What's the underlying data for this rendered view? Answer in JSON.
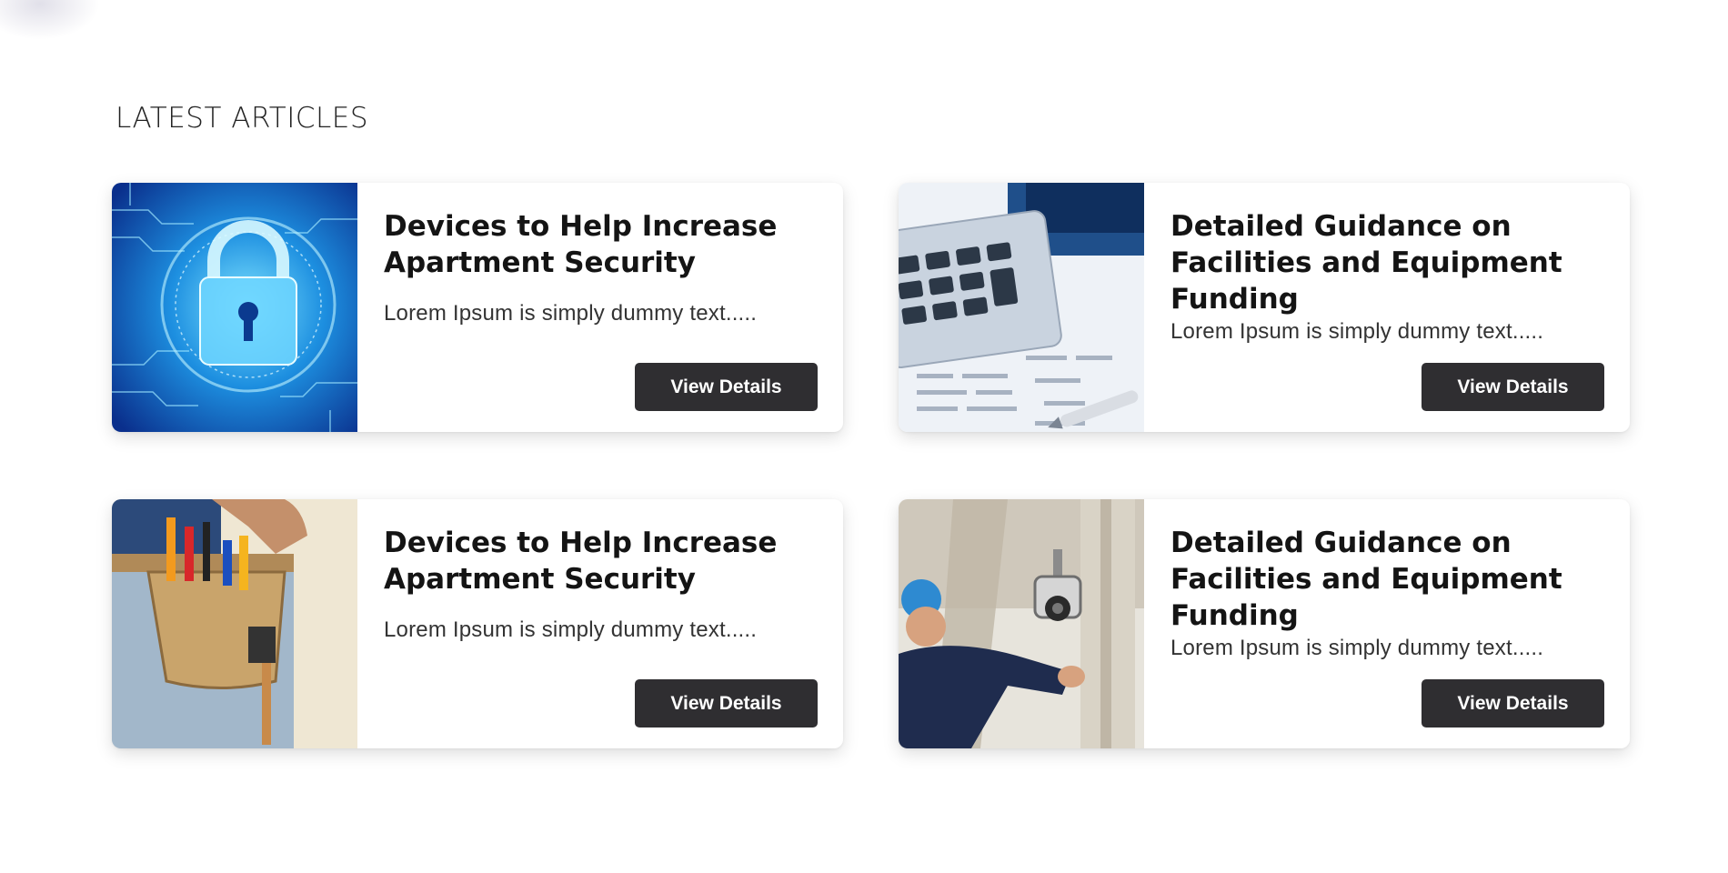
{
  "section": {
    "title": "LATEST ARTICLES"
  },
  "articles": [
    {
      "image_icon": "padlock-circuit-image",
      "title": "Devices to Help Increase Apartment Security",
      "excerpt": "Lorem Ipsum is simply dummy text.....",
      "button_label": "View Details"
    },
    {
      "image_icon": "calculator-finance-image",
      "title": "Detailed Guidance on Facilities and Equipment Funding",
      "excerpt": "Lorem Ipsum is simply dummy text.....",
      "button_label": "View Details"
    },
    {
      "image_icon": "tool-belt-image",
      "title": "Devices to Help Increase Apartment Security",
      "excerpt": "Lorem Ipsum is simply dummy text.....",
      "button_label": "View Details"
    },
    {
      "image_icon": "security-camera-install-image",
      "title": "Detailed Guidance on Facilities and Equipment Funding",
      "excerpt": "Lorem Ipsum is simply dummy text.....",
      "button_label": "View Details"
    }
  ],
  "colors": {
    "button_bg": "#2f2e31",
    "button_text": "#ffffff",
    "page_bg": "#ffffff"
  }
}
